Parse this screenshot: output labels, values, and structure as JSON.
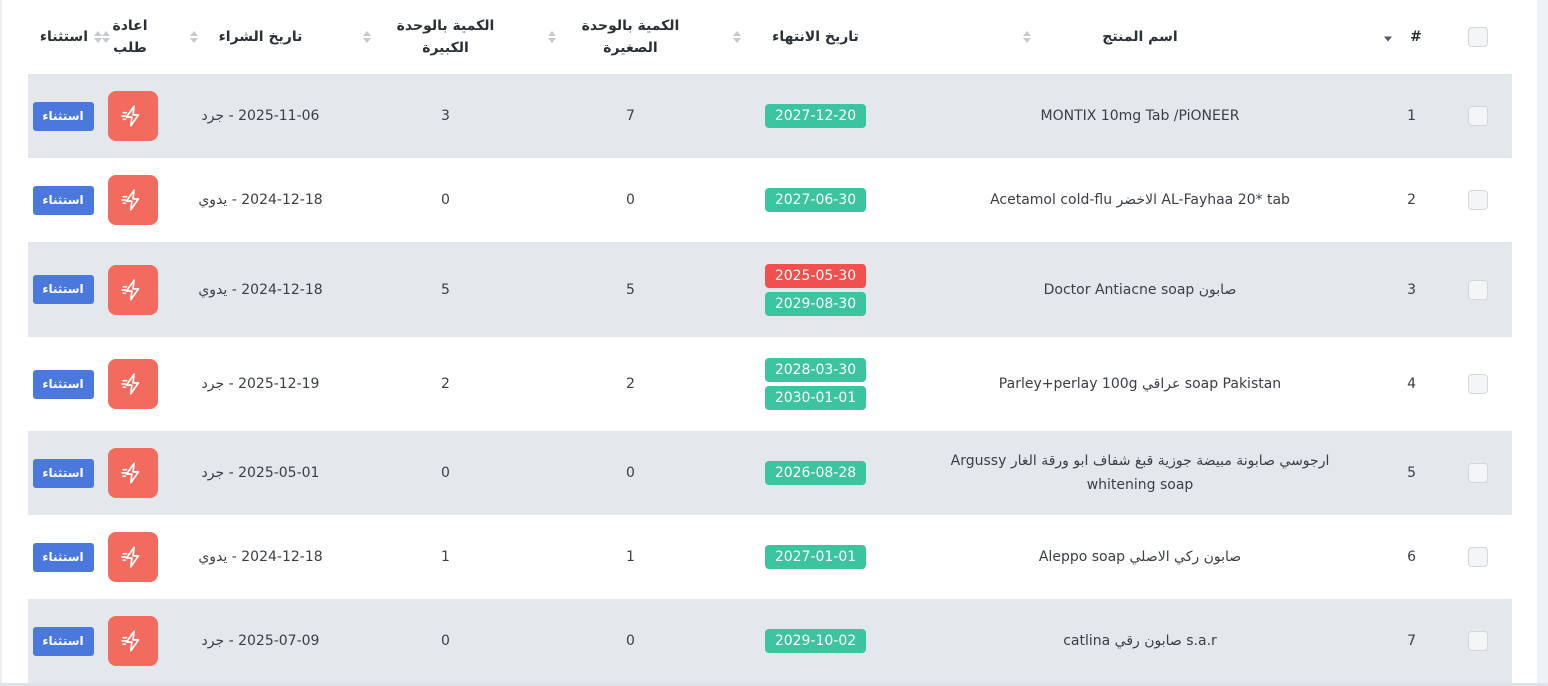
{
  "colors": {
    "badge_green": "#3cc39f",
    "badge_red": "#f0504e",
    "reorder_button": "#f26b5e",
    "except_button": "#4a78dc",
    "row_shaded": "#e4e7ec"
  },
  "headers": {
    "index": "#",
    "product_name": "اسم المنتج",
    "expiry_date": "تاريخ الانتهاء",
    "small_unit_qty": "الكمية بالوحدة الصغيرة",
    "large_unit_qty": "الكمية بالوحدة الكبيرة",
    "purchase_date": "تاريخ الشراء",
    "reorder": "اعادة طلب",
    "exception": "استثناء"
  },
  "reorder_icon": "lightning-bolt-icon",
  "rows": [
    {
      "index": "1",
      "name": "MONTIX 10mg Tab /PiONEER",
      "expiry": [
        {
          "date": "2027-12-20",
          "status": "green"
        }
      ],
      "small_qty": "7",
      "large_qty": "3",
      "purchase": "2025-11-06 - جرد",
      "except_label": "استثناء"
    },
    {
      "index": "2",
      "name": "Acetamol cold-flu الاخضر AL-Fayhaa 20* tab",
      "expiry": [
        {
          "date": "2027-06-30",
          "status": "green"
        }
      ],
      "small_qty": "0",
      "large_qty": "0",
      "purchase": "2024-12-18 - يدوي",
      "except_label": "استثناء"
    },
    {
      "index": "3",
      "name": "Doctor Antiacne soap صابون",
      "expiry": [
        {
          "date": "2025-05-30",
          "status": "red"
        },
        {
          "date": "2029-08-30",
          "status": "green"
        }
      ],
      "small_qty": "5",
      "large_qty": "5",
      "purchase": "2024-12-18 - يدوي",
      "except_label": "استثناء"
    },
    {
      "index": "4",
      "name": "Parley+perlay 100g عراقي soap Pakistan",
      "expiry": [
        {
          "date": "2028-03-30",
          "status": "green"
        },
        {
          "date": "2030-01-01",
          "status": "green"
        }
      ],
      "small_qty": "2",
      "large_qty": "2",
      "purchase": "2025-12-19 - جرد",
      "except_label": "استثناء"
    },
    {
      "index": "5",
      "name": "ارجوسي صابونة مبيضة جوزية قبغ شفاف ابو ورقة الغار Argussy whitening soap",
      "expiry": [
        {
          "date": "2026-08-28",
          "status": "green"
        }
      ],
      "small_qty": "0",
      "large_qty": "0",
      "purchase": "2025-05-01 - جرد",
      "except_label": "استثناء"
    },
    {
      "index": "6",
      "name": "Aleppo soap صابون ركي الاصلي",
      "expiry": [
        {
          "date": "2027-01-01",
          "status": "green"
        }
      ],
      "small_qty": "1",
      "large_qty": "1",
      "purchase": "2024-12-18 - يدوي",
      "except_label": "استثناء"
    },
    {
      "index": "7",
      "name": "catlina صابون رقي s.a.r",
      "expiry": [
        {
          "date": "2029-10-02",
          "status": "green"
        }
      ],
      "small_qty": "0",
      "large_qty": "0",
      "purchase": "2025-07-09 - جرد",
      "except_label": "استثناء"
    }
  ]
}
